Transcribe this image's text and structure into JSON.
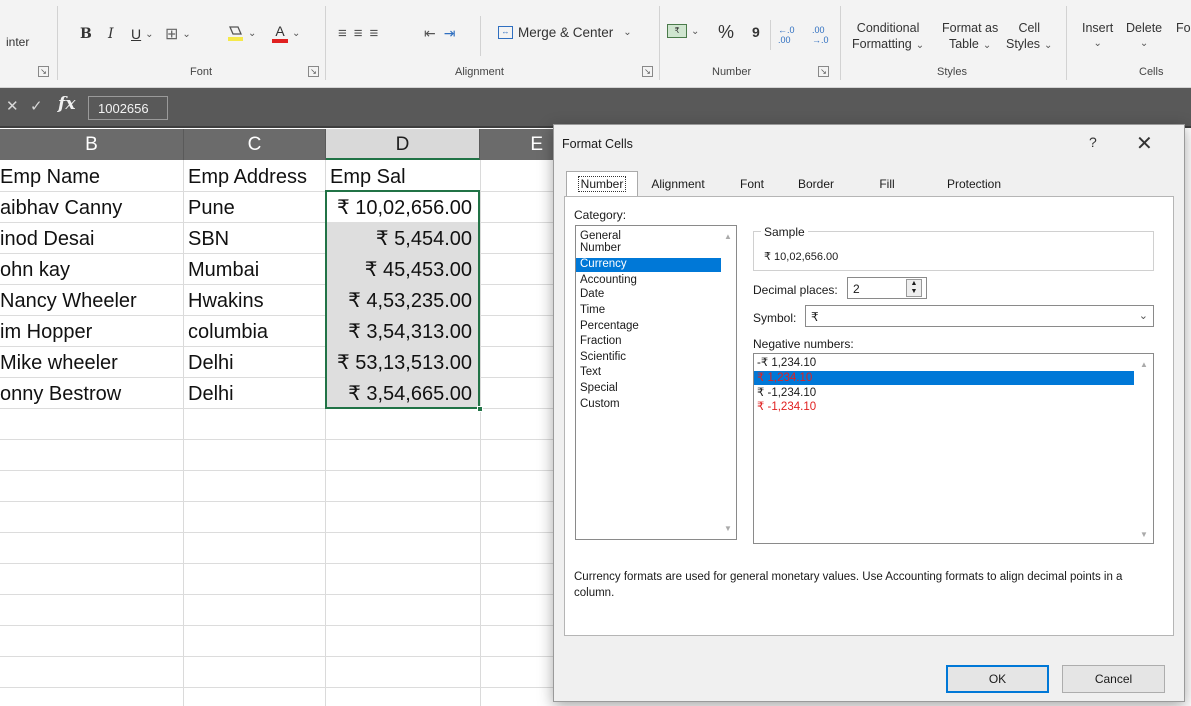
{
  "ribbon": {
    "painter_label": "inter",
    "font_group": "Font",
    "alignment_group": "Alignment",
    "number_group": "Number",
    "styles_group": "Styles",
    "cells_group": "Cells",
    "bold": "B",
    "italic": "I",
    "underline": "U",
    "font_color": "A",
    "merge_center": "Merge & Center",
    "percent": "%",
    "comma": "9",
    "inc_decimal": "←.0 .00",
    "dec_decimal": ".00 →.0",
    "cond_fmt_1": "Conditional",
    "cond_fmt_2": "Formatting",
    "fmt_table_1": "Format as",
    "fmt_table_2": "Table",
    "cell_styles_1": "Cell",
    "cell_styles_2": "Styles",
    "insert": "Insert",
    "delete": "Delete",
    "format_partial": "Fo"
  },
  "formula_bar": {
    "cancel_glyph": "✕",
    "enter_glyph": "✓",
    "fx": "fx",
    "value": "1002656"
  },
  "grid": {
    "columns": [
      "B",
      "C",
      "D",
      "E"
    ],
    "headers": {
      "b": "Emp Name",
      "c": "Emp Address",
      "d": "Emp Sal"
    },
    "rows": [
      {
        "name": "aibhav Canny",
        "address": "Pune",
        "salary": "₹ 10,02,656.00"
      },
      {
        "name": "inod Desai",
        "address": "SBN",
        "salary": "₹ 5,454.00"
      },
      {
        "name": "ohn kay",
        "address": "Mumbai",
        "salary": "₹ 45,453.00"
      },
      {
        "name": "Nancy Wheeler",
        "address": "Hwakins",
        "salary": "₹ 4,53,235.00"
      },
      {
        "name": "im Hopper",
        "address": "columbia",
        "salary": "₹ 3,54,313.00"
      },
      {
        "name": "Mike wheeler",
        "address": "Delhi",
        "salary": "₹ 53,13,513.00"
      },
      {
        "name": "onny  Bestrow",
        "address": "Delhi",
        "salary": "₹ 3,54,665.00"
      }
    ]
  },
  "dialog": {
    "title": "Format Cells",
    "help": "?",
    "close": "✕",
    "tabs": [
      "Number",
      "Alignment",
      "Font",
      "Border",
      "Fill",
      "Protection"
    ],
    "category_label": "Category:",
    "categories": [
      "General",
      "Number",
      "Currency",
      "Accounting",
      "Date",
      "Time",
      "Percentage",
      "Fraction",
      "Scientific",
      "Text",
      "Special",
      "Custom"
    ],
    "selected_category": "Currency",
    "sample_label": "Sample",
    "sample_value": "₹ 10,02,656.00",
    "decimal_label": "Decimal places:",
    "decimal_value": "2",
    "symbol_label": "Symbol:",
    "symbol_value": "₹",
    "negative_label": "Negative numbers:",
    "negative_options": [
      "-₹ 1,234.10",
      "₹ 1,234.10",
      "₹ -1,234.10",
      "₹ -1,234.10"
    ],
    "description": "Currency formats are used for general monetary values.  Use Accounting formats to align decimal points in a column.",
    "ok": "OK",
    "cancel": "Cancel"
  },
  "colors": {
    "excel_green": "#217346",
    "selection_blue": "#0078d7",
    "negative_red": "#e02020"
  }
}
